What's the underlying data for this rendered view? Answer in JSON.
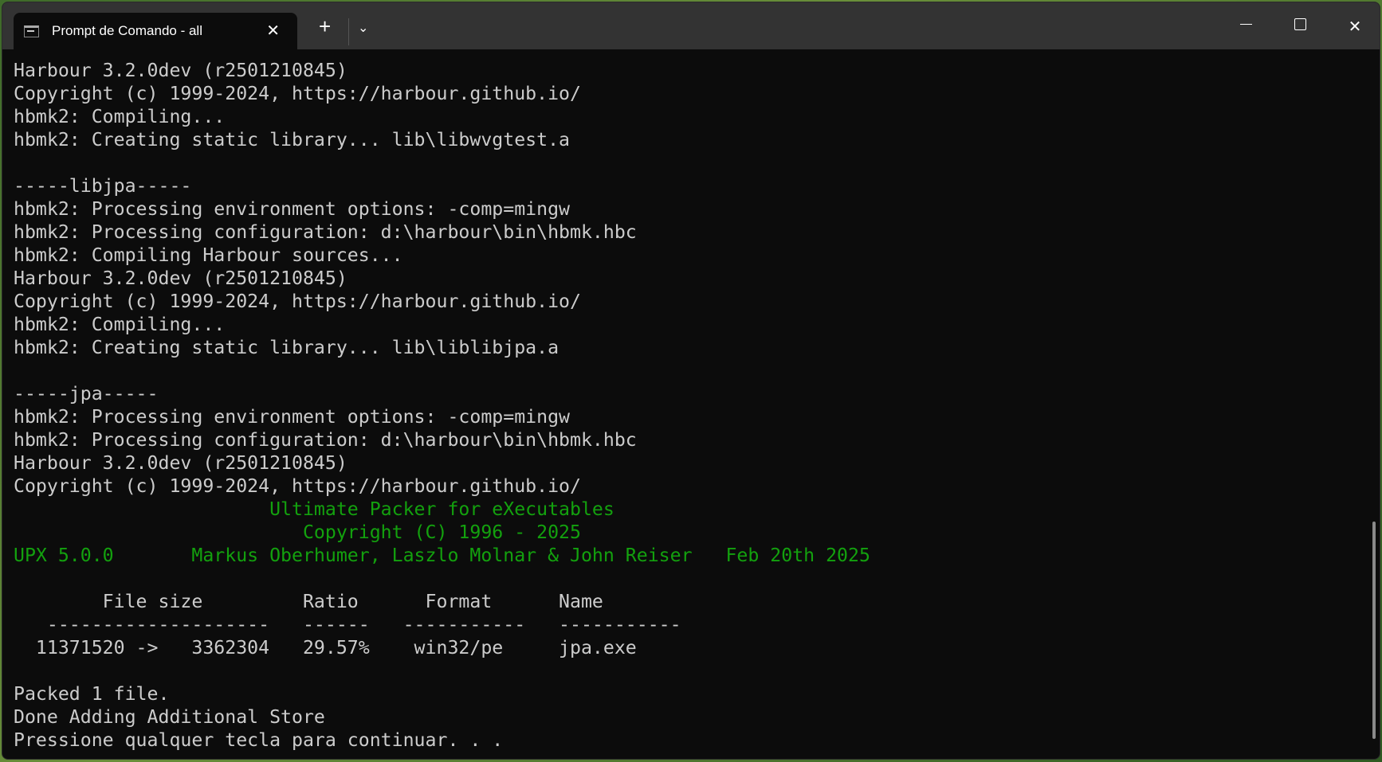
{
  "window": {
    "tab_title": "Prompt de Comando - all",
    "tab_close": "✕",
    "new_tab": "+",
    "dropdown": "⌄",
    "close": "✕"
  },
  "colors": {
    "text": "#cccccc",
    "green": "#13a10e",
    "background": "#0c0c0c",
    "titlebar": "#333333"
  },
  "console": {
    "lines": [
      {
        "text": "Harbour 3.2.0dev (r2501210845)",
        "color": "default"
      },
      {
        "text": "Copyright (c) 1999-2024, https://harbour.github.io/",
        "color": "default"
      },
      {
        "text": "hbmk2: Compiling...",
        "color": "default"
      },
      {
        "text": "hbmk2: Creating static library... lib\\libwvgtest.a",
        "color": "default"
      },
      {
        "text": "",
        "color": "default"
      },
      {
        "text": "-----libjpa-----",
        "color": "default"
      },
      {
        "text": "hbmk2: Processing environment options: -comp=mingw",
        "color": "default"
      },
      {
        "text": "hbmk2: Processing configuration: d:\\harbour\\bin\\hbmk.hbc",
        "color": "default"
      },
      {
        "text": "hbmk2: Compiling Harbour sources...",
        "color": "default"
      },
      {
        "text": "Harbour 3.2.0dev (r2501210845)",
        "color": "default"
      },
      {
        "text": "Copyright (c) 1999-2024, https://harbour.github.io/",
        "color": "default"
      },
      {
        "text": "hbmk2: Compiling...",
        "color": "default"
      },
      {
        "text": "hbmk2: Creating static library... lib\\liblibjpa.a",
        "color": "default"
      },
      {
        "text": "",
        "color": "default"
      },
      {
        "text": "-----jpa-----",
        "color": "default"
      },
      {
        "text": "hbmk2: Processing environment options: -comp=mingw",
        "color": "default"
      },
      {
        "text": "hbmk2: Processing configuration: d:\\harbour\\bin\\hbmk.hbc",
        "color": "default"
      },
      {
        "text": "Harbour 3.2.0dev (r2501210845)",
        "color": "default"
      },
      {
        "text": "Copyright (c) 1999-2024, https://harbour.github.io/",
        "color": "default"
      },
      {
        "text": "                       Ultimate Packer for eXecutables",
        "color": "green"
      },
      {
        "text": "                          Copyright (C) 1996 - 2025",
        "color": "green"
      },
      {
        "text": "UPX 5.0.0       Markus Oberhumer, Laszlo Molnar & John Reiser   Feb 20th 2025",
        "color": "green"
      },
      {
        "text": "",
        "color": "default"
      },
      {
        "text": "        File size         Ratio      Format      Name",
        "color": "default"
      },
      {
        "text": "   --------------------   ------   -----------   -----------",
        "color": "default"
      },
      {
        "text": "  11371520 ->   3362304   29.57%    win32/pe     jpa.exe",
        "color": "default"
      },
      {
        "text": "",
        "color": "default"
      },
      {
        "text": "Packed 1 file.",
        "color": "default"
      },
      {
        "text": "Done Adding Additional Store",
        "color": "default"
      },
      {
        "text": "Pressione qualquer tecla para continuar. . .",
        "color": "default"
      }
    ]
  }
}
